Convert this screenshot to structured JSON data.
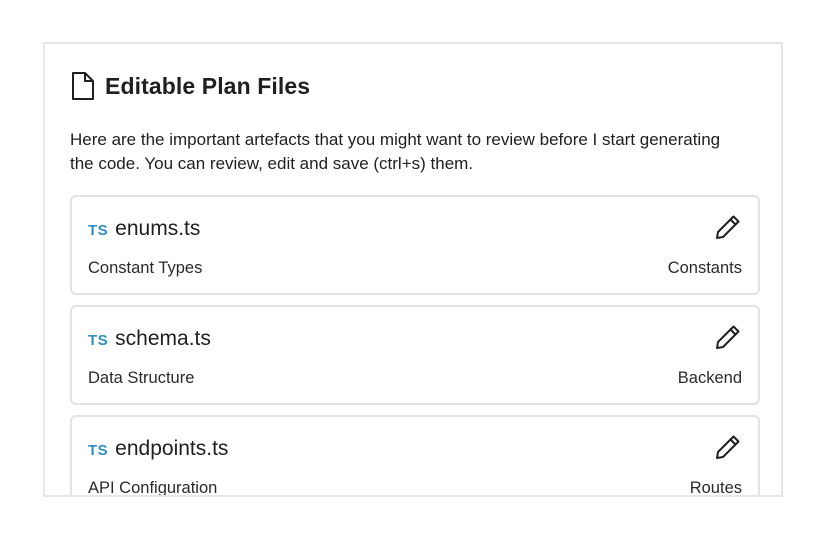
{
  "panel": {
    "title": "Editable Plan Files",
    "title_icon": "document-icon",
    "description": "Here are the important artefacts that you might want to review before I start generating the code. You can review, edit and save (ctrl+s) them."
  },
  "files": [
    {
      "badge": "TS",
      "name": "enums.ts",
      "description": "Constant Types",
      "category": "Constants",
      "action_icon": "pencil-icon"
    },
    {
      "badge": "TS",
      "name": "schema.ts",
      "description": "Data Structure",
      "category": "Backend",
      "action_icon": "pencil-icon"
    },
    {
      "badge": "TS",
      "name": "endpoints.ts",
      "description": "API Configuration",
      "category": "Routes",
      "action_icon": "pencil-icon"
    }
  ],
  "colors": {
    "ts_badge": "#2f8fc4",
    "border": "#e2e2e2",
    "text": "#1f1f1f"
  }
}
